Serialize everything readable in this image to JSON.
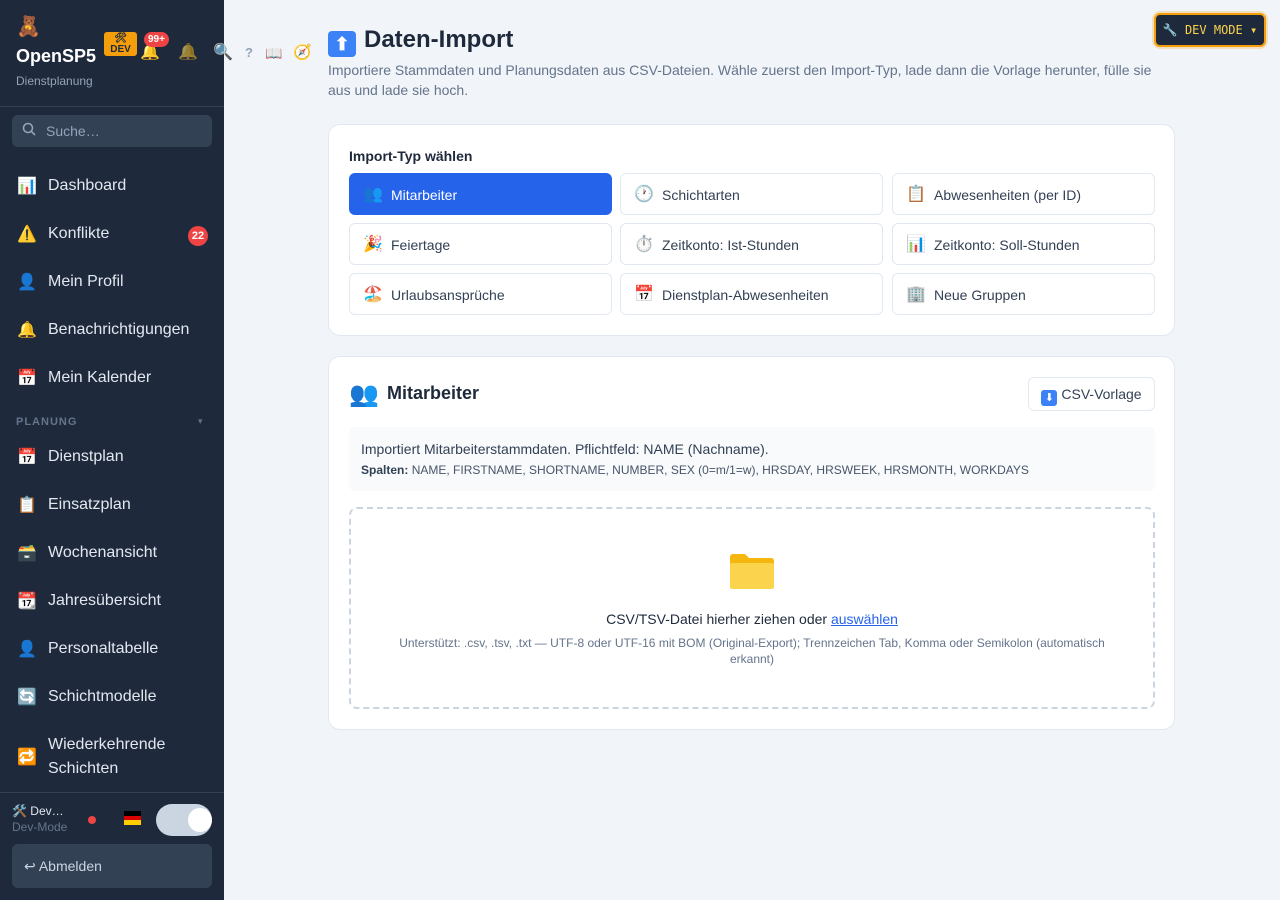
{
  "app": {
    "name": "OpenSP5",
    "subtitle": "Dienstplanung",
    "logo_glyph": "🧸",
    "dev_badge": "🛠 DEV",
    "notification_count": "99+"
  },
  "top_icons": [
    "bell-icon",
    "bell-outline-icon",
    "search-icon",
    "help-icon",
    "book-icon",
    "compass-icon"
  ],
  "top_glyphs": {
    "bell": "🔔",
    "bell_outline": "🔔",
    "search": "🔍",
    "help": "?",
    "book": "📖",
    "compass": "🧭"
  },
  "search": {
    "placeholder": "Suche…"
  },
  "nav": {
    "items": [
      {
        "icon": "📊",
        "label": "Dashboard"
      },
      {
        "icon": "⚠️",
        "label": "Konflikte",
        "badge": "22"
      },
      {
        "icon": "👤",
        "label": "Mein Profil"
      },
      {
        "icon": "🔔",
        "label": "Benachrichtigungen"
      },
      {
        "icon": "📅",
        "label": "Mein Kalender"
      }
    ],
    "section_label": "PLANUNG",
    "section_caret": "▾",
    "planning_items": [
      {
        "icon": "📅",
        "label": "Dienstplan"
      },
      {
        "icon": "📋",
        "label": "Einsatzplan"
      },
      {
        "icon": "🗃️",
        "label": "Wochenansicht"
      },
      {
        "icon": "📆",
        "label": "Jahresübersicht"
      },
      {
        "icon": "👤",
        "label": "Personaltabelle"
      },
      {
        "icon": "🔄",
        "label": "Schichtmodelle"
      },
      {
        "icon": "🔁",
        "label": "Wiederkehrende"
      },
      {
        "icon": "",
        "label": "Schichten"
      }
    ]
  },
  "footer": {
    "user_name": "🛠️ Dev…",
    "user_role": "Dev-Mode",
    "logout_label": "↩ Abmelden"
  },
  "dev_mode_button": "🔧 DEV MODE ▾",
  "page": {
    "title_icon": "⬆",
    "title": "Daten-Import",
    "description": "Importiere Stammdaten und Planungsdaten aus CSV-Dateien. Wähle zuerst den Import-Typ, lade dann die Vorlage herunter, fülle sie aus und lade sie hoch."
  },
  "import_types": {
    "heading": "Import-Typ wählen",
    "buttons": [
      {
        "icon": "👥",
        "label": "Mitarbeiter",
        "active": true
      },
      {
        "icon": "🕐",
        "label": "Schichtarten"
      },
      {
        "icon": "📋",
        "label": "Abwesenheiten (per ID)"
      },
      {
        "icon": "🎉",
        "label": "Feiertage"
      },
      {
        "icon": "⏱️",
        "label": "Zeitkonto: Ist-Stunden"
      },
      {
        "icon": "📊",
        "label": "Zeitkonto: Soll-Stunden"
      },
      {
        "icon": "🏖️",
        "label": "Urlaubsansprüche"
      },
      {
        "icon": "📅",
        "label": "Dienstplan-Abwesenheiten"
      },
      {
        "icon": "🏢",
        "label": "Neue Gruppen"
      }
    ]
  },
  "selected_import": {
    "icon": "👥",
    "title": "Mitarbeiter",
    "template_button_icon": "⬇",
    "template_button": "CSV-Vorlage",
    "info": "Importiert Mitarbeiterstammdaten. Pflichtfeld: NAME (Nachname).",
    "columns_label": "Spalten:",
    "columns": "NAME, FIRSTNAME, SHORTNAME, NUMBER, SEX (0=m/1=w), HRSDAY, HRSWEEK, HRSMONTH, WORKDAYS",
    "drop_text": "CSV/TSV-Datei hierher ziehen oder",
    "drop_link": "auswählen",
    "drop_hint": "Unterstützt: .csv, .tsv, .txt — UTF-8 oder UTF-16 mit BOM (Original-Export); Trennzeichen Tab, Komma oder Semikolon (automatisch erkannt)"
  },
  "colors": {
    "sidebar": "#1e293b",
    "accent": "#2563eb",
    "warning": "#f59e0b",
    "danger": "#ef4444"
  }
}
